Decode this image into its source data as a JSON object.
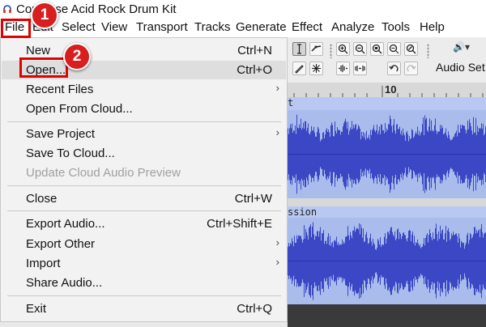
{
  "app": {
    "title": "Compose Acid Rock Drum Kit"
  },
  "menubar": {
    "items": [
      {
        "label": "File"
      },
      {
        "label": "Edit"
      },
      {
        "label": "Select"
      },
      {
        "label": "View"
      },
      {
        "label": "Transport"
      },
      {
        "label": "Tracks"
      },
      {
        "label": "Generate"
      },
      {
        "label": "Effect"
      },
      {
        "label": "Analyze"
      },
      {
        "label": "Tools"
      },
      {
        "label": "Help"
      }
    ]
  },
  "file_menu": {
    "items": [
      {
        "label": "New",
        "shortcut": "Ctrl+N"
      },
      {
        "label": "Open...",
        "shortcut": "Ctrl+O"
      },
      {
        "label": "Recent Files",
        "submenu_arrow": "›"
      },
      {
        "label": "Open From Cloud..."
      },
      {
        "label": "Save Project",
        "submenu_arrow": "›"
      },
      {
        "label": "Save To Cloud..."
      },
      {
        "label": "Update Cloud Audio Preview",
        "disabled": true
      },
      {
        "label": "Close",
        "shortcut": "Ctrl+W"
      },
      {
        "label": "Export Audio...",
        "shortcut": "Ctrl+Shift+E"
      },
      {
        "label": "Export Other",
        "submenu_arrow": "›"
      },
      {
        "label": "Import",
        "submenu_arrow": "›"
      },
      {
        "label": "Share Audio..."
      },
      {
        "label": "Exit",
        "shortcut": "Ctrl+Q"
      }
    ]
  },
  "toolbar": {
    "audio_setup_label": "Audio Set",
    "audio_icon_glyph": "🔊▾",
    "icons": [
      "select-tool-icon",
      "envelope-tool-icon",
      "draw-tool-icon",
      "multi-tool-icon",
      "zoom-in-icon",
      "zoom-out-icon",
      "fit-selection-icon",
      "fit-project-icon",
      "zoom-toggle-icon",
      "trim-audio-icon",
      "silence-audio-icon",
      "undo-icon",
      "redo-icon",
      "audio-setup-icon"
    ]
  },
  "ruler": {
    "tick_label": "10"
  },
  "tracks": [
    {
      "name_fragment": "t"
    },
    {
      "name_fragment": "ssion"
    }
  ],
  "annotations": [
    {
      "number": "1"
    },
    {
      "number": "2"
    }
  ],
  "colors": {
    "highlight_red": "#e10000",
    "badge_red": "#d81e1e",
    "waveform_blue": "#3b47c4",
    "track_background": "#a9bcec",
    "menu_background": "#f2f2f2"
  }
}
